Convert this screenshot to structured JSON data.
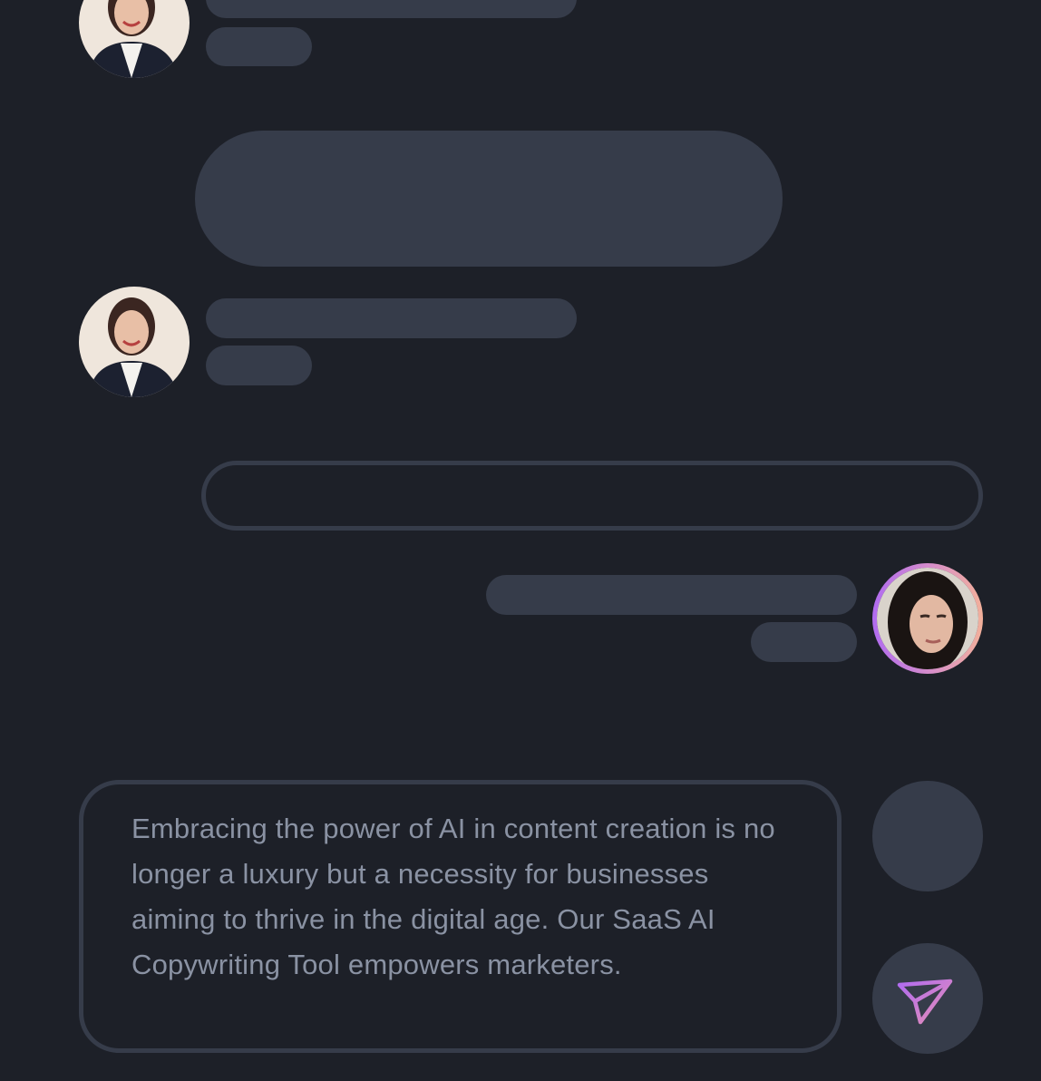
{
  "colors": {
    "background": "#1d2028",
    "skeleton": "#363c4a",
    "text_muted": "#8a92a3",
    "accent_gradient": [
      "#b06bf0",
      "#f2b09a"
    ]
  },
  "chat": {
    "messages": [
      {
        "sender": "other",
        "avatar": "woman-smiling-avatar",
        "placeholder": true
      },
      {
        "sender": "other-large-bubble",
        "placeholder": true
      },
      {
        "sender": "other",
        "avatar": "woman-smiling-avatar",
        "placeholder": true
      },
      {
        "sender": "system-outline-pill",
        "placeholder": true
      },
      {
        "sender": "self",
        "avatar": "woman-dark-hair-avatar",
        "placeholder": true
      }
    ]
  },
  "composer": {
    "text": "Embracing the power of AI in content creation is no longer a luxury but a necessity for businesses aiming to thrive in the digital age. Our SaaS AI Copywriting Tool empowers marketers."
  },
  "actions": {
    "attach_icon": "blank-circle",
    "send_icon": "send-icon"
  }
}
